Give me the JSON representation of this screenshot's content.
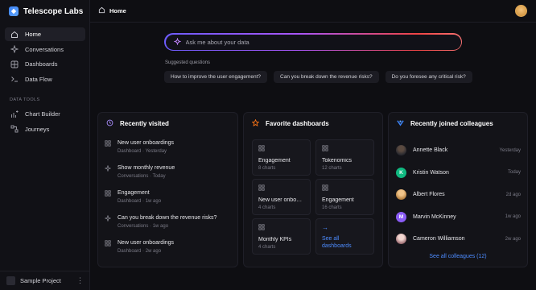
{
  "app": {
    "name": "Telescope Labs"
  },
  "sidebar": {
    "items": [
      {
        "label": "Home",
        "icon": "home-icon"
      },
      {
        "label": "Conversations",
        "icon": "sparkle-icon"
      },
      {
        "label": "Dashboards",
        "icon": "grid-icon"
      },
      {
        "label": "Data Flow",
        "icon": "terminal-icon"
      }
    ],
    "section_label": "DATA TOOLS",
    "tools": [
      {
        "label": "Chart Builder",
        "icon": "chart-builder-icon"
      },
      {
        "label": "Journeys",
        "icon": "journey-icon"
      }
    ],
    "footer": {
      "project": "Sample Project"
    }
  },
  "topbar": {
    "title": "Home"
  },
  "search": {
    "placeholder": "Ask me about your data"
  },
  "suggestions": {
    "label": "Suggested questions",
    "items": [
      "How to improve the user engagement?",
      "Can you break down the revenue risks?",
      "Do you foresee any critical risk?"
    ]
  },
  "recent": {
    "title": "Recently visited",
    "items": [
      {
        "title": "New user onboardings",
        "type": "Dashboard",
        "when": "Yesterday",
        "icon": "grid-icon"
      },
      {
        "title": "Show monthly revenue",
        "type": "Conversations",
        "when": "Today",
        "icon": "sparkle-icon"
      },
      {
        "title": "Engagement",
        "type": "Dashboard",
        "when": "1w ago",
        "icon": "grid-icon"
      },
      {
        "title": "Can you break down the revenue risks?",
        "type": "Conversations",
        "when": "1w ago",
        "icon": "sparkle-icon"
      },
      {
        "title": "New user onboardings",
        "type": "Dashboard",
        "when": "2w ago",
        "icon": "grid-icon"
      }
    ]
  },
  "favorites": {
    "title": "Favorite dashboards",
    "items": [
      {
        "title": "Engagement",
        "sub": "8 charts"
      },
      {
        "title": "Tokenomics",
        "sub": "12 charts"
      },
      {
        "title": "New user onboardings",
        "sub": "4 charts"
      },
      {
        "title": "Engagement",
        "sub": "16 charts"
      },
      {
        "title": "Monthly KPIs",
        "sub": "4 charts"
      }
    ],
    "see_all": "See all dashboards"
  },
  "colleagues": {
    "title": "Recently joined colleagues",
    "items": [
      {
        "name": "Annette Black",
        "when": "Yesterday",
        "avatar": "photo",
        "color": "#2a2a30",
        "initial": ""
      },
      {
        "name": "Kristin Watson",
        "when": "Today",
        "avatar": "initial",
        "color": "#10b981",
        "initial": "K"
      },
      {
        "name": "Albert Flores",
        "when": "2d ago",
        "avatar": "photo",
        "color": "#d9a15a",
        "initial": ""
      },
      {
        "name": "Marvin McKinney",
        "when": "1w ago",
        "avatar": "initial",
        "color": "#8b5cf6",
        "initial": "M"
      },
      {
        "name": "Cameron Williamson",
        "when": "2w ago",
        "avatar": "photo",
        "color": "#e8c4c8",
        "initial": ""
      }
    ],
    "see_all": "See all colleagues (12)"
  },
  "colors": {
    "accent": "#4d8cff",
    "brand": "#3b82f6",
    "background": "#0e0e12"
  }
}
